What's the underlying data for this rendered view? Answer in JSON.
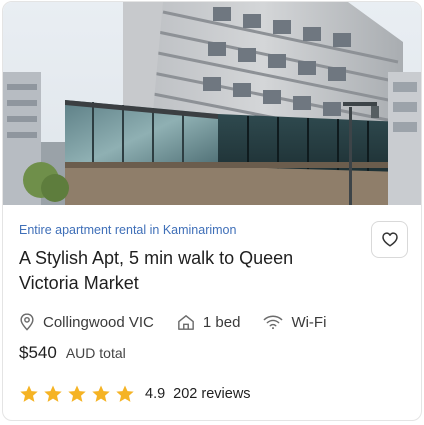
{
  "listing": {
    "category": "Entire apartment rental in Kaminarimon",
    "title": "A Stylish Apt, 5 min walk to Queen Victoria Market",
    "favorite_icon": "heart-outline-icon",
    "amenities": [
      {
        "icon": "location-pin-icon",
        "label": "Collingwood VIC"
      },
      {
        "icon": "home-icon",
        "label": "1 bed"
      },
      {
        "icon": "wifi-icon",
        "label": "Wi-Fi"
      }
    ],
    "price": "$540",
    "price_unit": "AUD total",
    "rating": {
      "value": "4.9",
      "stars": 5,
      "reviews": "202 reviews"
    }
  },
  "colors": {
    "category_text": "#3f6fb8",
    "star": "#f5b324",
    "border": "#e4e4e4"
  }
}
